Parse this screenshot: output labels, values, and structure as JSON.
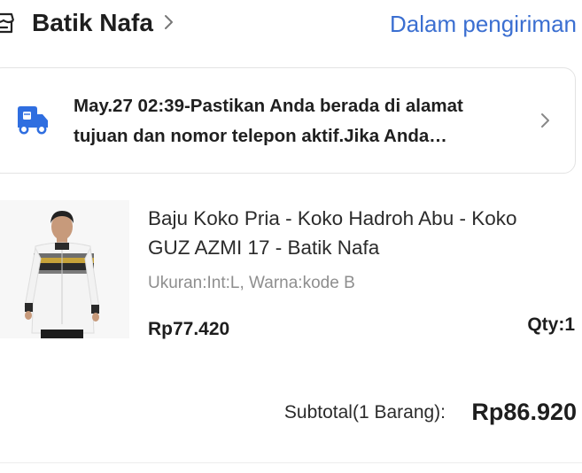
{
  "store": {
    "name": "Batik Nafa",
    "status": "Dalam pengiriman",
    "store_icon": "store-icon",
    "chevron_icon": "chevron-right-icon"
  },
  "tracking": {
    "text": "May.27 02:39-Pastikan Anda berada di alamat tujuan dan nomor telepon aktif.Jika Anda…",
    "icon": "truck-icon",
    "chevron_icon": "chevron-right-icon"
  },
  "product": {
    "title": "Baju Koko Pria - Koko Hadroh Abu - Koko GUZ AZMI 17 - Batik Nafa",
    "variant": "Ukuran:Int:L, Warna:kode B",
    "price": "Rp77.420",
    "qty": "Qty:1",
    "image": "product-photo"
  },
  "summary": {
    "subtotal_label": "Subtotal(1 Barang):",
    "subtotal_value": "Rp86.920"
  },
  "colors": {
    "status": "#3b6fd1",
    "truck_icon": "#2f6ee0",
    "text_primary": "#1e1e1e",
    "text_secondary": "#8e8e8e"
  }
}
